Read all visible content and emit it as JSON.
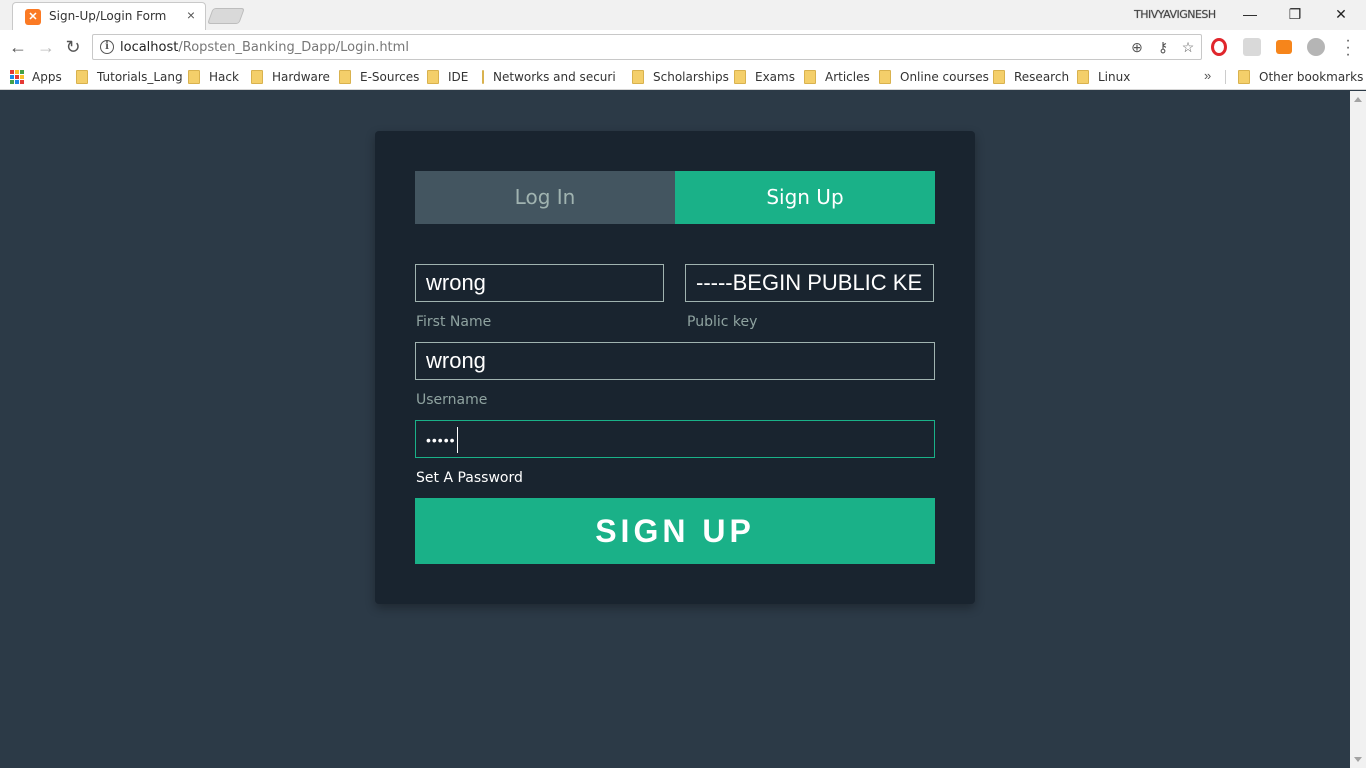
{
  "browser": {
    "tab_title": "Sign-Up/Login Form",
    "tab_close": "×",
    "profile_name": "THIVYAVIGNESH",
    "window_controls": {
      "minimize": "—",
      "restore": "❐",
      "close": "✕"
    },
    "url_host": "localhost",
    "url_path": "/Ropsten_Banking_Dapp/Login.html",
    "bookmarks": [
      "Tutorials_Lang",
      "Hack",
      "Hardware",
      "E-Sources",
      "IDE",
      "Networks and securit",
      "Scholarships",
      "Exams",
      "Articles",
      "Online courses",
      "Research",
      "Linux"
    ],
    "apps_label": "Apps",
    "other_bookmarks": "Other bookmarks",
    "overflow": "»"
  },
  "form": {
    "tabs": {
      "login": "Log In",
      "signup": "Sign Up"
    },
    "active_tab": "signup",
    "first_name": {
      "value": "wrong",
      "label": "First Name"
    },
    "public_key": {
      "value": "-----BEGIN PUBLIC KE",
      "label": "Public key"
    },
    "username": {
      "value": "wrong",
      "label": "Username"
    },
    "password": {
      "value": "•••••",
      "label": "Set A Password"
    },
    "submit_label": "SIGN UP"
  },
  "colors": {
    "accent": "#1ab188",
    "page_bg": "#2c3a47",
    "card_bg": "#19242f",
    "inactive_tab": "#435560"
  }
}
